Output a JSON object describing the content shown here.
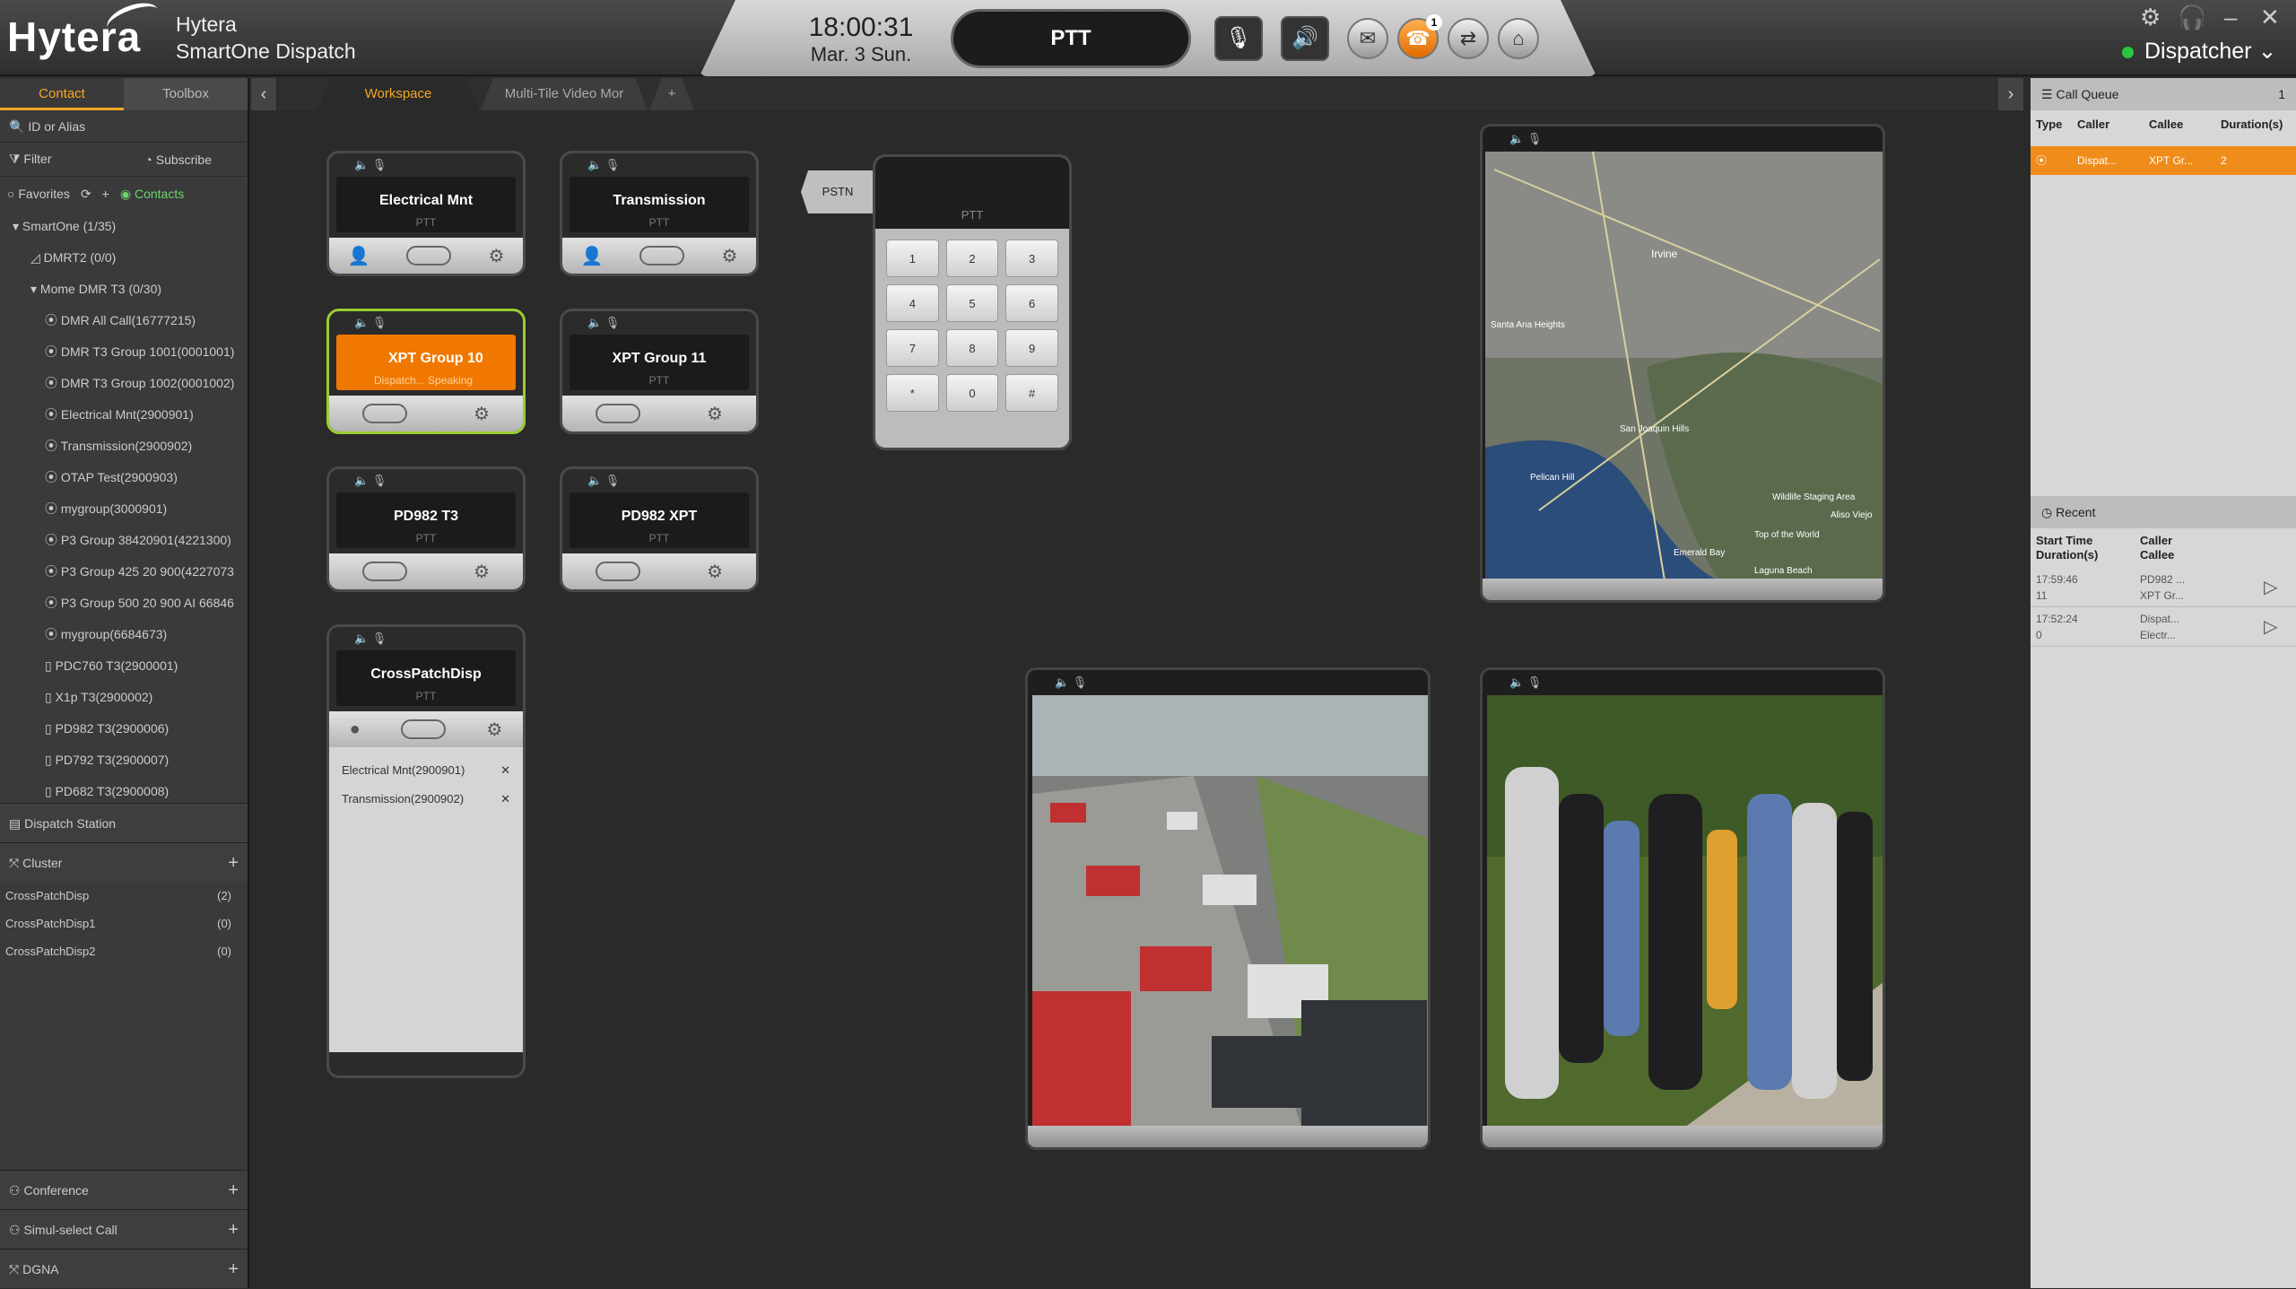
{
  "app": {
    "brand": "Hytera",
    "title_line1": "Hytera",
    "title_line2": "SmartOne Dispatch",
    "time": "18:00:31",
    "date": "Mar. 3 Sun.",
    "ptt": "PTT",
    "user": "Dispatcher",
    "badge_count": "1"
  },
  "window": {
    "minimize": "–",
    "close": "✕"
  },
  "left": {
    "tabs": [
      "Contact",
      "Toolbox"
    ],
    "search_placeholder": "ID or Alias",
    "filter": "Filter",
    "subscribe": "Subscribe",
    "favorites": "Favorites",
    "contacts": "Contacts",
    "tree": [
      "SmartOne (1/35)",
      "DMRT2 (0/0)",
      "Mome DMR T3 (0/30)",
      "DMR All Call(16777215)",
      "DMR T3 Group 1001(0001001)",
      "DMR T3 Group 1002(0001002)",
      "Electrical Mnt(2900901)",
      "Transmission(2900902)",
      "OTAP Test(2900903)",
      "mygroup(3000901)",
      "P3 Group 38420901(4221300)",
      "P3 Group 425 20 900(4227073",
      "P3 Group 500 20 900 AI 66846",
      "mygroup(6684673)",
      "PDC760 T3(2900001)",
      "X1p T3(2900002)",
      "PD982 T3(2900006)",
      "PD792 T3(2900007)",
      "PD682 T3(2900008)"
    ],
    "dispatch_station": "Dispatch Station",
    "cluster": "Cluster",
    "cluster_items": [
      {
        "name": "CrossPatchDisp",
        "count": "(2)"
      },
      {
        "name": "CrossPatchDisp1",
        "count": "(0)"
      },
      {
        "name": "CrossPatchDisp2",
        "count": "(0)"
      }
    ],
    "conference": "Conference",
    "simul": "Simul-select Call",
    "dgna": "DGNA"
  },
  "workspace": {
    "tabs": [
      "Workspace",
      "Multi-Tile Video Mor",
      "+"
    ]
  },
  "tiles": [
    {
      "name": "Electrical Mnt",
      "sub": "PTT"
    },
    {
      "name": "Transmission",
      "sub": "PTT"
    },
    {
      "name": "XPT Group 10",
      "sub": "Dispatch... Speaking"
    },
    {
      "name": "XPT Group 11",
      "sub": "PTT"
    },
    {
      "name": "PD982 T3",
      "sub": "PTT"
    },
    {
      "name": "PD982 XPT",
      "sub": "PTT"
    },
    {
      "name": "CrossPatchDisp",
      "sub": "PTT",
      "members": [
        "Electrical Mnt(2900901)",
        "Transmission(2900902)"
      ]
    }
  ],
  "pstn": {
    "label": "PSTN",
    "ptt": "PTT",
    "keys": [
      "1",
      "2",
      "3",
      "4",
      "5",
      "6",
      "7",
      "8",
      "9",
      "*",
      "0",
      "#"
    ]
  },
  "map_labels": [
    "Irvine",
    "Santa Ana Heights",
    "San Joaquin Hills",
    "Pelican Hill",
    "Top of the World",
    "Emerald Bay",
    "Laguna Beach",
    "Aliso Viejo",
    "Wildlife Staging Area"
  ],
  "right": {
    "call_queue": "Call Queue",
    "queue_count": "1",
    "cols": [
      "Type",
      "Caller",
      "Callee",
      "Duration(s)"
    ],
    "queue_row": {
      "caller": "Dispat...",
      "callee": "XPT Gr...",
      "duration": "2"
    },
    "recent": "Recent",
    "recent_cols": [
      "Start Time",
      "Caller",
      "Duration(s)",
      "Callee"
    ],
    "recent_rows": [
      {
        "time": "17:59:46",
        "dur": "11",
        "caller": "PD982 ...",
        "callee": "XPT Gr..."
      },
      {
        "time": "17:52:24",
        "dur": "0",
        "caller": "Dispat...",
        "callee": "Electr..."
      }
    ]
  }
}
